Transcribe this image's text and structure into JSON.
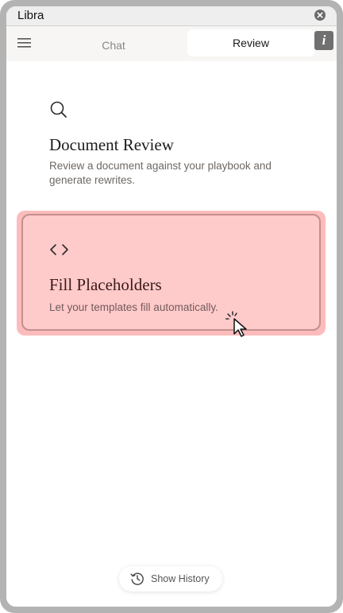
{
  "window": {
    "title": "Libra"
  },
  "tabs": {
    "chat_label": "Chat",
    "review_label": "Review",
    "active": "Review",
    "info_glyph": "i"
  },
  "cards": [
    {
      "icon": "search-icon",
      "title": "Document Review",
      "description": "Review a document against your playbook and generate rewrites."
    },
    {
      "icon": "code-brackets-icon",
      "title": "Fill Placeholders",
      "description": "Let your templates fill automatically.",
      "highlighted": true
    }
  ],
  "footer": {
    "history_label": "Show History"
  },
  "colors": {
    "frame": "#b3b3b3",
    "highlight_fill": "#ffcaca",
    "highlight_border": "#c48e8e",
    "tab_active_bg": "#ffffff",
    "info_button": "#707070"
  }
}
